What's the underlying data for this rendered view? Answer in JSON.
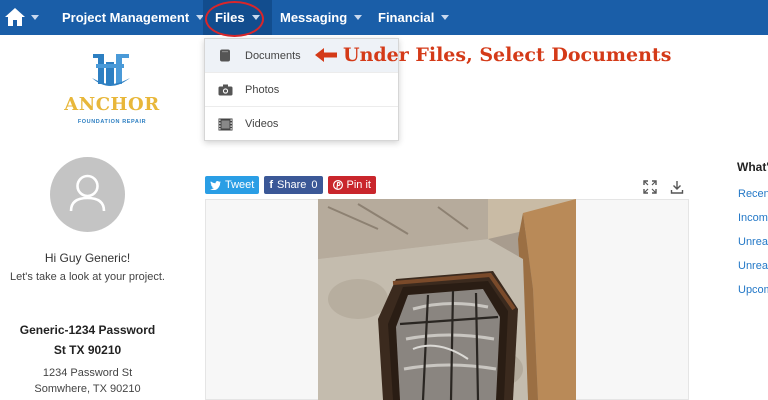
{
  "nav": {
    "items": [
      {
        "label": "Project Management"
      },
      {
        "label": "Files"
      },
      {
        "label": "Messaging"
      },
      {
        "label": "Financial"
      }
    ]
  },
  "files_menu": {
    "items": [
      {
        "label": "Documents",
        "icon": "document-icon"
      },
      {
        "label": "Photos",
        "icon": "camera-icon"
      },
      {
        "label": "Videos",
        "icon": "film-icon"
      }
    ]
  },
  "annotation": {
    "text": "Under Files, Select Documents",
    "color": "#d43a18"
  },
  "logo": {
    "name": "ANCHOR",
    "tagline": "FOUNDATION REPAIR"
  },
  "profile": {
    "greeting": "Hi Guy Generic!",
    "subtext": "Let's take a look at your project.",
    "project_line1": "Generic-1234 Password",
    "project_line2": "St TX 90210",
    "address_line1": "1234 Password St",
    "address_line2": "Somwhere, TX 90210"
  },
  "share": {
    "tweet": "Tweet",
    "facebook": "Share",
    "facebook_count": "0",
    "pinterest": "Pin it"
  },
  "right_panel": {
    "title": "What's",
    "links": [
      "Recen",
      "Incomp",
      "Unrea",
      "Unrea",
      "Upcom"
    ]
  },
  "colors": {
    "nav_bg": "#1a5ea8",
    "nav_active": "#124d8e",
    "link": "#2478c7",
    "highlight": "#d9262a"
  }
}
